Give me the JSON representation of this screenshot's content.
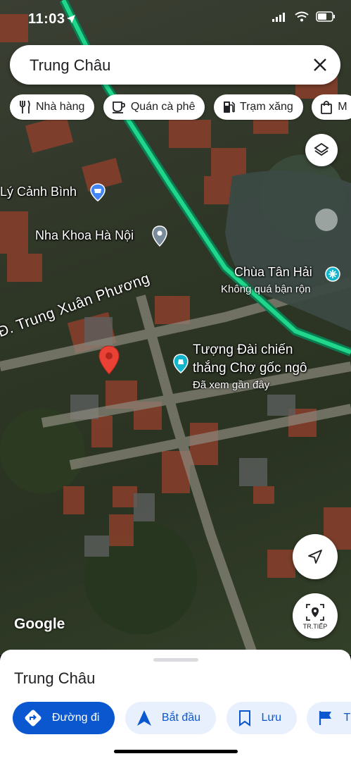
{
  "status_bar": {
    "time": "11:03",
    "icons": [
      "location-arrow-icon",
      "signal-icon",
      "wifi-icon",
      "battery-icon"
    ]
  },
  "search": {
    "query": "Trung Châu"
  },
  "chips": [
    {
      "label": "Nhà hàng",
      "icon": "restaurant-icon"
    },
    {
      "label": "Quán cà phê",
      "icon": "coffee-icon"
    },
    {
      "label": "Trạm xăng",
      "icon": "gas-station-icon"
    },
    {
      "label": "M",
      "icon": "shopping-bag-icon"
    }
  ],
  "map": {
    "labels": {
      "ly_canh_binh": "Lý Cảnh Bình",
      "nha_khoa": "Nha Khoa Hà Nội",
      "chua_tan_hai": "Chùa Tân Hải",
      "chua_status": "Không quá bận rộn",
      "road": "Đ. Trung Xuân Phương",
      "tuong_dai_1": "Tượng Đài chiến",
      "tuong_dai_2": "thắng Chợ gốc ngô",
      "tuong_dai_status": "Đã xem gần đây"
    },
    "google_logo": "Google",
    "live_view_label": "TR.TIẾP",
    "colors": {
      "route_green": "#1fd68a",
      "pin_red": "#e94235"
    }
  },
  "sheet": {
    "place_name": "Trung Châu",
    "actions": [
      {
        "label": "Đường đi",
        "icon": "directions-icon"
      },
      {
        "label": "Bắt đầu",
        "icon": "navigation-icon"
      },
      {
        "label": "Lưu",
        "icon": "bookmark-icon"
      },
      {
        "label": "Thêm",
        "icon": "flag-icon"
      }
    ]
  }
}
